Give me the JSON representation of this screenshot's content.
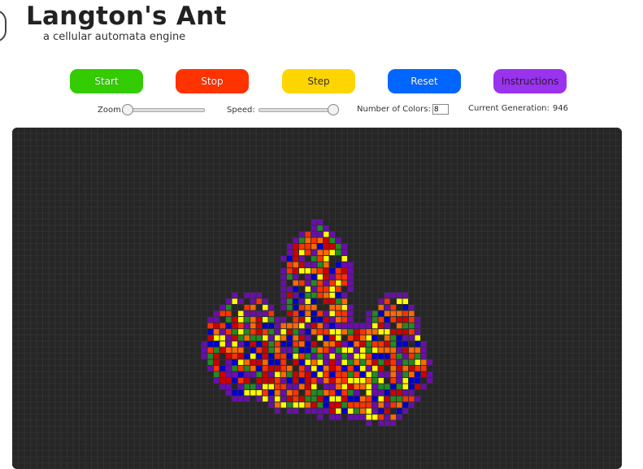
{
  "header": {
    "title": "Langton's Ant",
    "subtitle": "a cellular automata engine"
  },
  "toolbar": {
    "buttons": [
      {
        "label": "Start",
        "color": "#33cc00"
      },
      {
        "label": "Stop",
        "color": "#ff3300"
      },
      {
        "label": "Step",
        "color": "#ffd500"
      },
      {
        "label": "Reset",
        "color": "#0066ff"
      },
      {
        "label": "Instructions",
        "color": "#9933ee"
      }
    ]
  },
  "controls": {
    "zoom_label": "Zoom:",
    "zoom_level": 0.0,
    "speed_label": "Speed:",
    "speed_level": 0.95,
    "colors_label": "Number of Colors:",
    "colors_value": "8",
    "generation_label": "Current Generation:",
    "generation_value": "946"
  },
  "grid": {
    "background": "#262626",
    "gridline": "#3a3a3a",
    "palette": [
      "#ffff00",
      "#ff3300",
      "#ff6a00",
      "#0000cc",
      "#228b22",
      "#6a0dad",
      "#cc0000"
    ]
  }
}
